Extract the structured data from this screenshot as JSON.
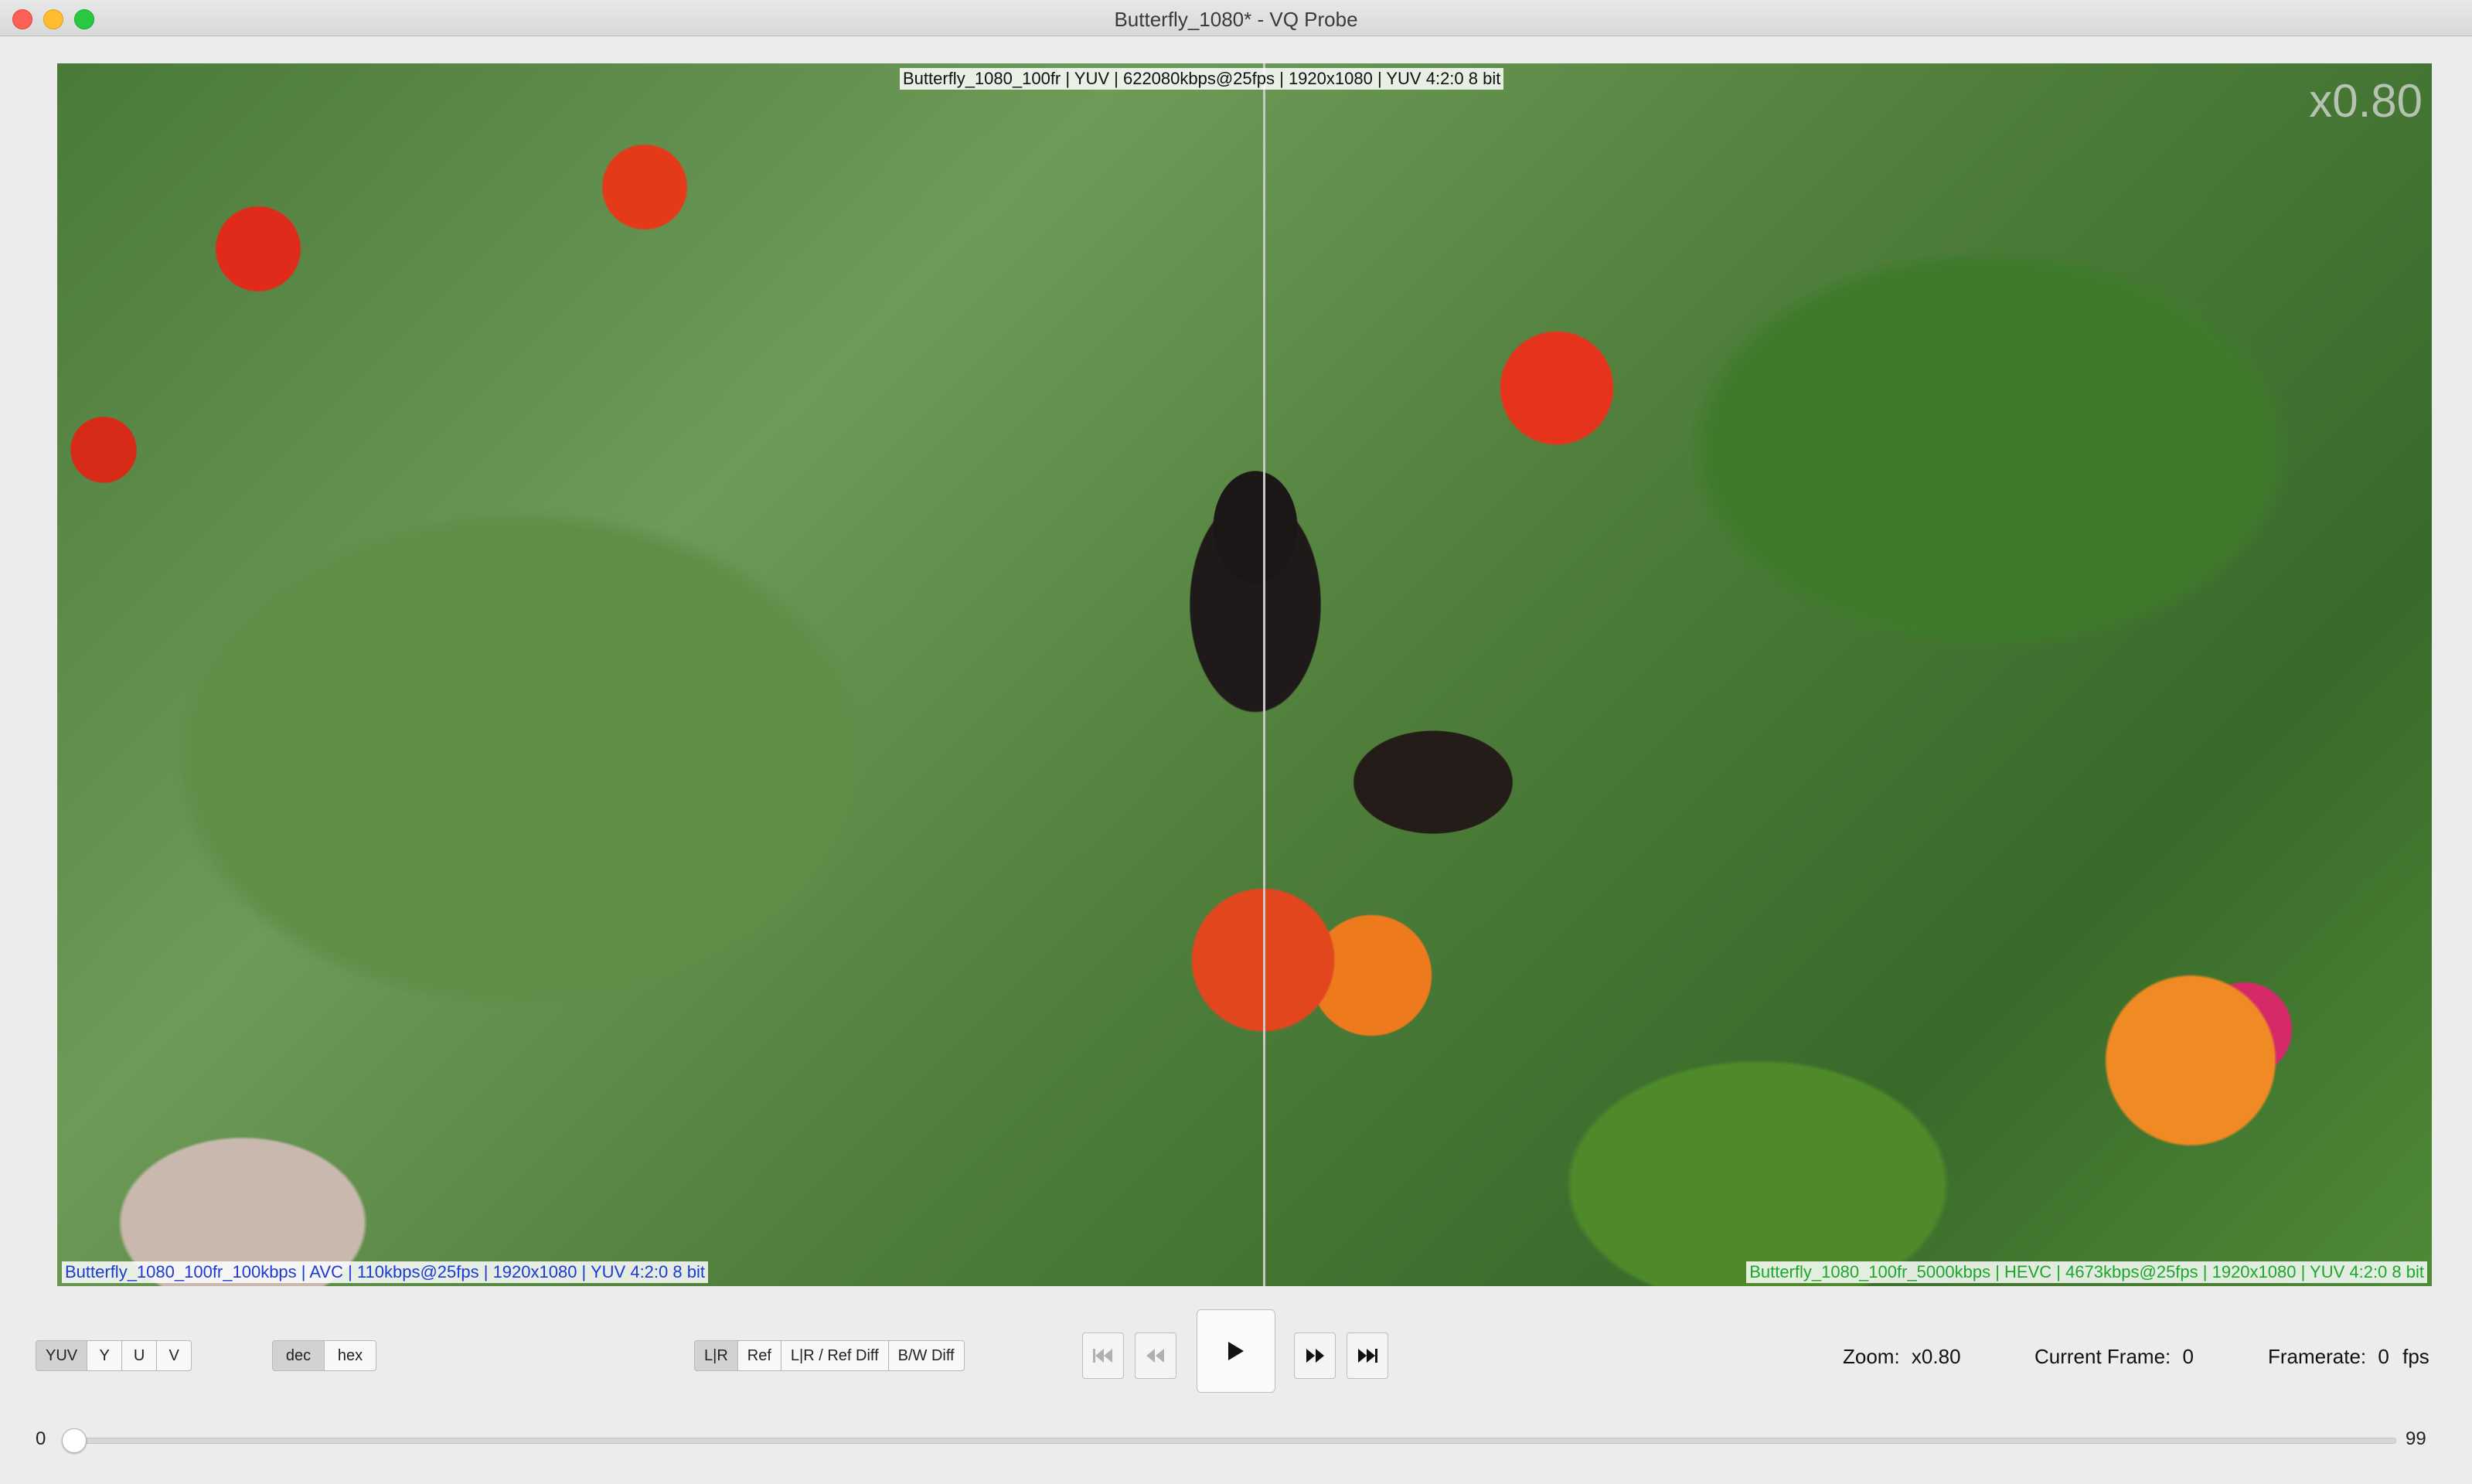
{
  "window": {
    "title": "Butterfly_1080* - VQ Probe"
  },
  "viewport": {
    "ref_label": "Butterfly_1080_100fr | YUV | 622080kbps@25fps | 1920x1080 | YUV 4:2:0 8 bit",
    "left_label": "Butterfly_1080_100fr_100kbps | AVC | 110kbps@25fps | 1920x1080 | YUV 4:2:0 8 bit",
    "right_label": "Butterfly_1080_100fr_5000kbps | HEVC | 4673kbps@25fps | 1920x1080 | YUV 4:2:0 8 bit",
    "zoom_overlay": "x0.80"
  },
  "toolbar": {
    "channels": [
      "YUV",
      "Y",
      "U",
      "V"
    ],
    "number_format": [
      "dec",
      "hex"
    ],
    "view_modes": [
      "L|R",
      "Ref",
      "L|R / Ref Diff",
      "B/W Diff"
    ],
    "transport_icons": [
      "skip-to-start-icon",
      "step-back-icon",
      "play-icon",
      "step-forward-icon",
      "skip-to-end-icon"
    ]
  },
  "status": {
    "zoom_label": "Zoom:",
    "zoom_value": "x0.80",
    "frame_label": "Current Frame:",
    "frame_value": "0",
    "framerate_label": "Framerate:",
    "framerate_value": "0",
    "framerate_unit": "fps"
  },
  "slider": {
    "min": "0",
    "max": "99",
    "value": 0
  }
}
